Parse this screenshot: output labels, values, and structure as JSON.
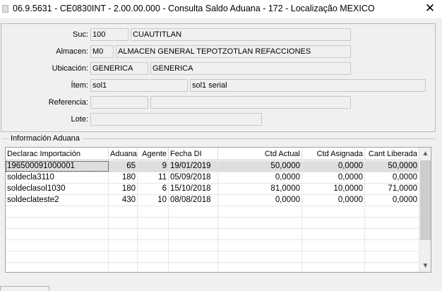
{
  "window": {
    "title": "06.9.5631 - CE0830INT - 2.00.00.000 - Consulta Saldo Aduana - 172 - Localização MEXICO"
  },
  "form": {
    "suc": {
      "label": "Suc:",
      "code": "100",
      "name": "CUAUTITLAN"
    },
    "almacen": {
      "label": "Almacen:",
      "code": "M0",
      "name": "ALMACEN GENERAL TEPOTZOTLAN REFACCIONES"
    },
    "ubicacion": {
      "label": "Ubicación:",
      "code": "GENERICA",
      "name": "GENERICA"
    },
    "item": {
      "label": "Ítem:",
      "code": "sol1",
      "name": "sol1 serial"
    },
    "referencia": {
      "label": "Referencia:",
      "code": "",
      "name": ""
    },
    "lote": {
      "label": "Lote:",
      "value": ""
    }
  },
  "aduana": {
    "group_label": "Información Aduana",
    "columns": [
      "Declarac Importación",
      "Aduana",
      "Agente",
      "Fecha DI",
      "Ctd Actual",
      "Ctd Asignada",
      "Cant Liberada"
    ],
    "rows": [
      {
        "declarac": "196500091000001",
        "aduana": "65",
        "agente": "9",
        "fecha": "19/01/2019",
        "actual": "50,0000",
        "asignada": "0,0000",
        "liberada": "50,0000"
      },
      {
        "declarac": "soldecla3110",
        "aduana": "180",
        "agente": "11",
        "fecha": "05/09/2018",
        "actual": "0,0000",
        "asignada": "0,0000",
        "liberada": "0,0000"
      },
      {
        "declarac": "soldeclasol1030",
        "aduana": "180",
        "agente": "6",
        "fecha": "15/10/2018",
        "actual": "81,0000",
        "asignada": "10,0000",
        "liberada": "71,0000"
      },
      {
        "declarac": "soldeclateste2",
        "aduana": "430",
        "agente": "10",
        "fecha": "08/08/2018",
        "actual": "0,0000",
        "asignada": "0,0000",
        "liberada": "0,0000"
      }
    ],
    "selected_row": 0
  },
  "icons": {
    "close": "close-icon",
    "app": "app-icon",
    "scroll_up": "chevron-up-icon",
    "scroll_down": "chevron-down-icon"
  },
  "colors": {
    "background": "#f0f0f0",
    "selected_row": "#dedede",
    "field_border": "#c8c8c8"
  }
}
